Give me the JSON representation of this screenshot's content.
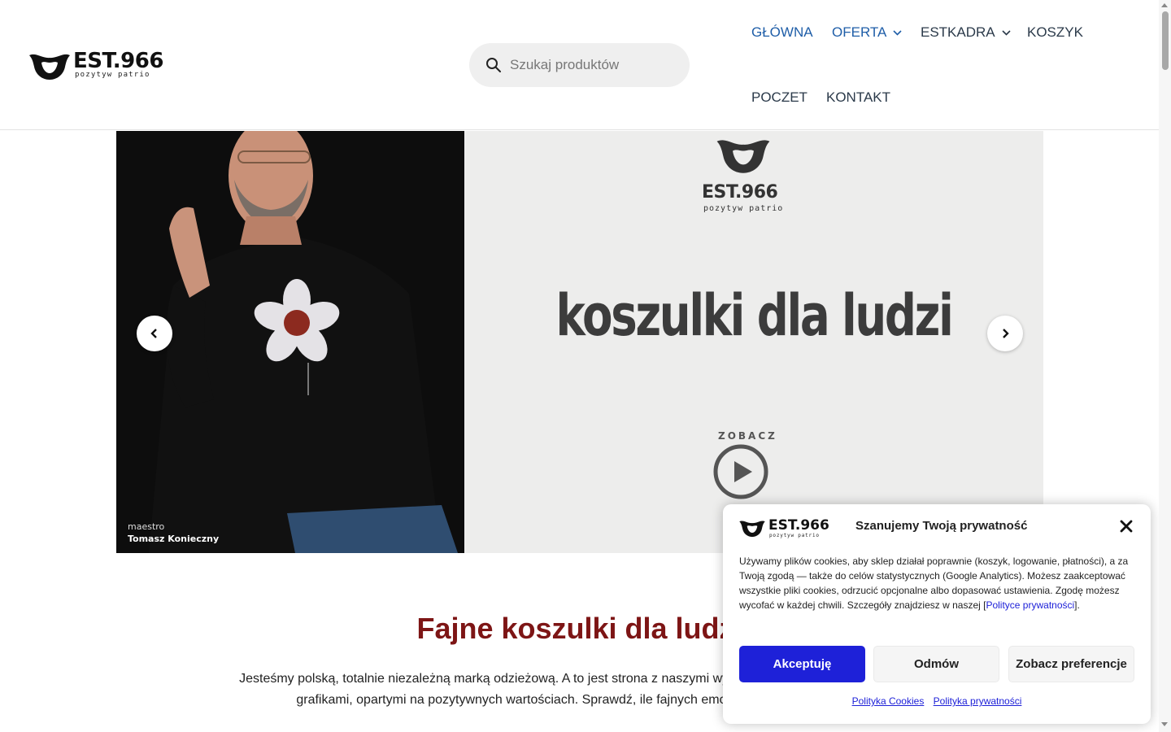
{
  "brand": {
    "logo_text": "EST.966",
    "logo_subtext": "pozytyw patrio"
  },
  "search": {
    "placeholder": "Szukaj produktów"
  },
  "nav": {
    "items": [
      {
        "label": "GŁÓWNA",
        "active": true,
        "has_dropdown": false
      },
      {
        "label": "OFERTA",
        "active": true,
        "has_dropdown": true
      },
      {
        "label": "ESTKADRA",
        "active": false,
        "has_dropdown": true
      },
      {
        "label": "KOSZYK",
        "active": false,
        "has_dropdown": false
      },
      {
        "label": "POCZET",
        "active": false,
        "has_dropdown": false
      },
      {
        "label": "KONTAKT",
        "active": false,
        "has_dropdown": false
      }
    ]
  },
  "slider": {
    "caption_role": "maestro",
    "caption_name": "Tomasz Konieczny",
    "headline": "koszulki dla ludzi",
    "brand_text": "EST.966",
    "brand_subtext": "pozytyw patrio",
    "video_label": "ZOBACZ",
    "prev_icon": "chevron-left-icon",
    "next_icon": "chevron-right-icon"
  },
  "content": {
    "heading": "Fajne koszulki dla ludzi",
    "intro_line1": "Jesteśmy polską, totalnie niezależną marką odzieżową. A to jest strona z naszymi wyjątkowymi ubraniami z autorskimi",
    "intro_line2": "grafikami, opartymi na pozytywnych wartościach. Sprawdź, ile fajnych emocji mogą nieść koszulki!"
  },
  "cookie_dialog": {
    "title": "Szanujemy Twoją prywatność",
    "text_before_link": "Używamy plików cookies, aby sklep działał poprawnie (koszyk, logowanie, płatności), a za Twoją zgodą — także do celów statystycznych (Google Analytics). Możesz zaakceptować wszystkie pliki cookies, odrzucić opcjonalne albo dopasować ustawienia. Zgodę możesz wycofać w każdej chwili. Szczegóły znajdziesz w naszej [",
    "text_link": "Polityce prywatności",
    "text_after_link": "].",
    "accept_label": "Akceptuję",
    "reject_label": "Odmów",
    "preferences_label": "Zobacz preferencje",
    "cookie_policy_link": "Polityka Cookies",
    "privacy_policy_link": "Polityka prywatności",
    "accent_color": "#1e21d8"
  },
  "colors": {
    "heading": "#7d1515",
    "nav_active": "#1f5ea8",
    "nav": "#2b3a4a"
  }
}
